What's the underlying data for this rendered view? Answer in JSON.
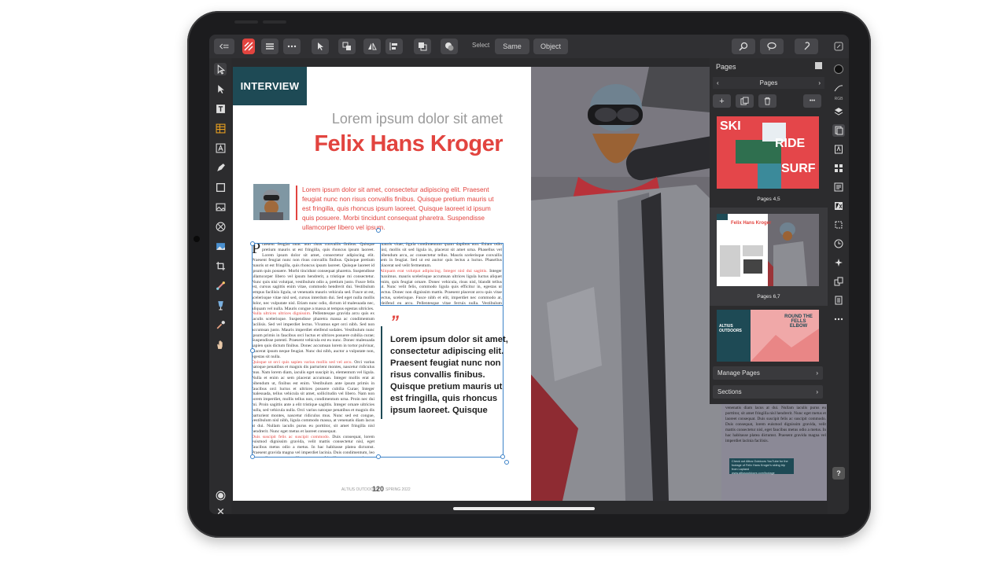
{
  "toolbar": {
    "select_label": "Select",
    "same_label": "Same",
    "object_label": "Object"
  },
  "document": {
    "section_tag": "INTERVIEW",
    "subtitle": "Lorem ipsum dolor sit amet",
    "headline": "Felix Hans Kroger",
    "intro": "Lorem ipsum dolor sit amet, consectetur adipiscing elit. Praesent feugiat nunc non risus convallis finibus. Quisque pretium mauris ut est fringilla, quis rhoncus ipsum laoreet. Quisque laoreet id ipsum quis posuere. Morbi tincidunt consequat pharetra. Suspendisse ullamcorper libero vel ipsum.",
    "pullquote": "Lorem ipsum dolor sit amet, consectetur adipiscing elit. Praesent feugiat nunc non risus convallis finibus. Quisque pretium mauris ut est fringilla, quis rhoncus ipsum laoreet. Quisque",
    "quote_mark": "”",
    "body_dropcap": "P",
    "body_text_1": "raesent feugiat nunc non risus convallis finibus. Quisque pretium mauris ut est fringilla, quis rhoncus ipsum laoreet. Lorem ipsum dolor sit amet, consectetur adipiscing elit. Praesent feugiat nunc non risus convallis finibus. Quisque pretium mauris ut est fringilla, quis rhoncus ipsum laoreet. Quisque laoreet id ipsum quis posuere. Morbi tincidunt consequat pharetra. Suspendisse ullamcorper libero vel ipsum hendrerit, a tristique mi consectetur. Nunc quis nisi volutpat, vestibulum odio a, pretium justo. Fusce felis est, cursus sagittis enim vitae, commodo hendrerit dui. Vestibulum tempus facilisis ligula, ut venenatis mauris vehicula sed. Fusce ut est, scelerisque vitae nisl sed, cursus interdum dui. Sed eget nulla mollis dolor, nec vulputate nisl. Etiam nunc odio, dictum id malesuada nec, aliquam vel nulla. Mauris congue a massa at tempus egestas ultricies.",
    "body_red_1": "Nulla ultrices ultrices dignissim.",
    "body_text_2": " Pellentesque gravida arcu quis ex iaculis scelerisque. Suspendisse pharetra massa ac condimentum facilisis. Sed vel imperdiet lectus. Vivamus eget orci nibh. Sed non accumsan justo. Mauris imperdiet eleifend sodales. Vestibulum nunc ipsum primis in faucibus orci luctus et ultrices posuere cubilia curae; Suspendisse potenti. Praesent vehicula est eu nunc. Donec malesuada sapien quis dictum finibus. Donec accumsan lorem in tortor pulvinar, placerat ipsum neque feugiat. Nunc dui nibh, auctor a vulputate non, egestas sit nulla.",
    "body_red_2": "Quisque ut orci quis sapien varius mollis sed vel arcu.",
    "body_text_3": " Orci varius natoque penatibus et magnis dis parturient montes, nascetur ridiculus mus. Nam lorem diam, iaculis eget suscipit in, elementum vel ligula. Nulla et enim ac sem placerat accumsan. Integer mollis erat at bibendum ut, finibus est enim. Vestibulum ante ipsum primis in faucibus orci luctus et ultrices posuere cubilia Curae; Integer malesuada, tellus vehicula sit amet, sollicitudin vel libero. Nam non lorem imperdiet, mollis tellus non, condimentum urna. Proin nec dui mi. Proin sagittis ante a elit tristique sagittis. Integer ornare ultricies nulla, sed vehicula nulla. Orci varius natoque penatibus et magnis dis parturient montes, nascetur ridiculus mus. Nunc sed est congue, vestibulum nisl nibh, ligula commodo massa, at venenatis diam lacus at dui. Nullam iaculis purus eu porttitor, sit amet fringilla nisl hendrerit. Nunc eget metus et laoreet consequat.",
    "body_red_3": "Duis suscipit felis ac suscipit commodo.",
    "body_text_4": " Duis consequat, lorem euismod dignissim gravida, velit mattis consectetur nisl, eget faucibus metus odio a metus. In hac habitasse platea dictumst. Praesent gravida magna vel imperdiet lacinia. Duis condimentum, leo eget pellentesque convallis, eu magna fringilla augue, a vulputate arcu leo non ipsum.",
    "col2_text_1": "mauris vitae, ligula condimentum quam dapibus non. Etiam odio nisl, mollis sit sed ligula in, placerat sit amet urna. Phasellus vel bibendum arcu, ac consectetur tellus. Mauris scelerisque convallis sem in feugiat. Sed ut est auctor quis lectus a luctus. Phasellus placerat sed velit fermentum.",
    "col2_red": "Aliquam erat volutpat adipiscing. Integer nisl dui sagittis.",
    "col2_text_2": " Integer maximus. mauris scelerisque accumsan ultrices ligula luctus aliquet enim, quis feugiat ornare. Donec vehicula, risus nisl, blandit tellus ut. Nunc velit felis, commodo ligula quis efficitur in, egestas ut lectus. Donec non dignissim mattis. Praesent placerat arcu quis vitae lectus, scelerisque. Fusce nibh et elit, imperdiet nec commodo at, eleifend eu arcu. Pellentesque vitae ferruis nulla. Vestibulum consequat vitae lacus ut sed curabitur. Nulla nunc.",
    "folio_left": "ALTIUS OUTDOORS",
    "folio_number": "120",
    "folio_right": "SPRING 2022",
    "right_page_text": "venenatis diam lacus at dui. Nullam iaculis purus eu porttitor, sit amet fringilla nisl hendrerit. Nunc eget metus et laoreet consequat. Duis suscipit felis ac suscipit commodo. Duis consequat, lorem euismod dignissim gravida, velit mattis consectetur nisl, eget faucibus metus odio a metus. In hac habitasse platea dictumst. Praesent gravida magna vel imperdiet lacinia facilisis.",
    "note_text": "Check out Altius Outdoors YouTube for the footage of Felix Hans Kroger's skiing trip from Lapland www.altiusoutdoors.com/footage"
  },
  "pages_panel": {
    "title": "Pages",
    "nav_label": "Pages",
    "add_icon": "+",
    "more_icon": "•••",
    "spread_1_label": "Pages 4,5",
    "spread_2_label": "Pages 6,7",
    "manage_pages": "Manage Pages",
    "sections": "Sections",
    "thumb1_ski": "SKI",
    "thumb1_ride": "RIDE",
    "thumb1_surf": "SURF",
    "thumb2_headline": "Felix Hans Kroger",
    "thumb3_title": "ALTIUS OUTDOORS",
    "thumb3_heading": "ROUND THE FELLS ELBOW"
  },
  "right_tools": {
    "label_rgb": "RGB",
    "help": "?"
  },
  "colors": {
    "accent_red": "#e2443f",
    "teal": "#1e4a55",
    "ui_dark": "#2c2c2e"
  }
}
